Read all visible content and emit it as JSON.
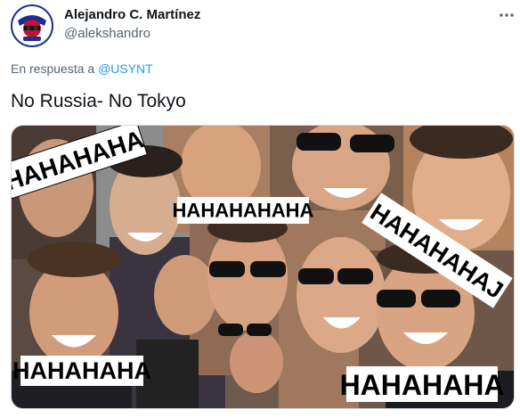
{
  "author": {
    "name": "Alejandro C. Martínez",
    "handle": "@alekshandro",
    "avatar_icon": "team-crest-avatar"
  },
  "more_icon": "ellipsis-icon",
  "reply": {
    "prefix": "En respuesta a ",
    "mention": "@USYNT"
  },
  "tweet": {
    "text": "No Russia- No Tokyo"
  },
  "media": {
    "captions": [
      "HAHAHAHA",
      "HAHAHAHAHA",
      "HAHAHAHAJ",
      "HAHAHAHA",
      "HAHAHAHA"
    ]
  },
  "colors": {
    "link": "#1d9bf0",
    "secondary_text": "#536471",
    "primary_text": "#0f1419",
    "avatar_ring": "#1b2f8f"
  }
}
